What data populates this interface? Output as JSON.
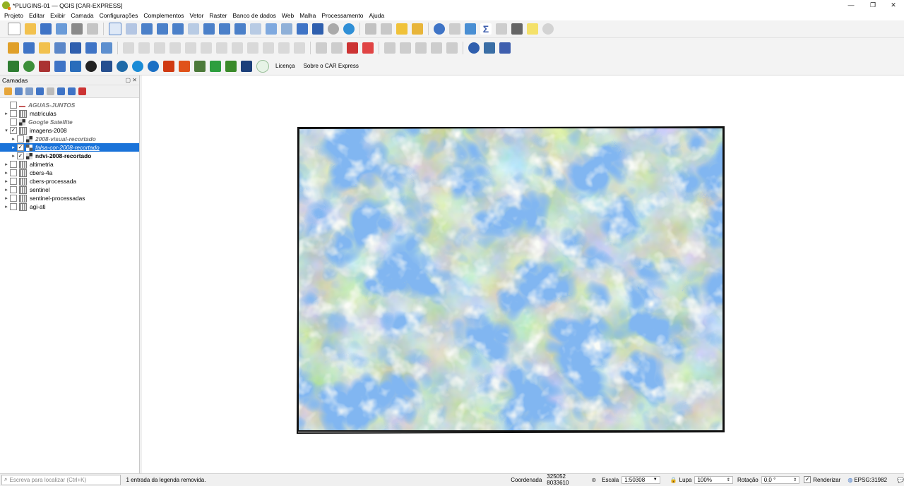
{
  "window": {
    "title": "*PLUGINS-01 — QGIS [CAR-EXPRESS]",
    "minimize": "—",
    "maximize": "❐",
    "close": "✕"
  },
  "menu": [
    "Projeto",
    "Editar",
    "Exibir",
    "Camada",
    "Configurações",
    "Complementos",
    "Vetor",
    "Raster",
    "Banco de dados",
    "Web",
    "Malha",
    "Processamento",
    "Ajuda"
  ],
  "plugin_toolbar": {
    "license": "Licença",
    "about": "Sobre o CAR Express"
  },
  "layers_panel": {
    "title": "Camadas",
    "layers": [
      {
        "name": "AGUAS-JUNTOS",
        "checked": false,
        "expand": "",
        "style": "it"
      },
      {
        "name": "matriculas",
        "checked": false,
        "expand": "▸",
        "style": ""
      },
      {
        "name": "Google Satellite",
        "checked": false,
        "expand": "",
        "style": "it"
      },
      {
        "name": "imagens-2008",
        "checked": true,
        "expand": "▾",
        "style": ""
      },
      {
        "name": "2008-visual-recortado",
        "checked": false,
        "expand": "▸",
        "style": "it"
      },
      {
        "name": "falsa-cor-2008-recortado",
        "checked": true,
        "expand": "▸",
        "style": "sel"
      },
      {
        "name": "ndvi-2008-recortado",
        "checked": true,
        "expand": "▸",
        "style": "bold"
      },
      {
        "name": "altimetria",
        "checked": false,
        "expand": "▸",
        "style": ""
      },
      {
        "name": "cbers-4a",
        "checked": false,
        "expand": "▸",
        "style": ""
      },
      {
        "name": "cbers-processada",
        "checked": false,
        "expand": "▸",
        "style": ""
      },
      {
        "name": "sentinel",
        "checked": false,
        "expand": "▸",
        "style": ""
      },
      {
        "name": "sentinel-processadas",
        "checked": false,
        "expand": "▸",
        "style": ""
      },
      {
        "name": "agi-ati",
        "checked": false,
        "expand": "▸",
        "style": ""
      }
    ]
  },
  "status": {
    "search_placeholder": "Escreva para localizar (Ctrl+K)",
    "message": "1 entrada da legenda removida.",
    "coord_label": "Coordenada",
    "coord_value": "325052  8033610",
    "scale_label": "Escala",
    "scale_value": "1:50308",
    "magnifier_label": "Lupa",
    "magnifier_value": "100%",
    "rotation_label": "Rotação",
    "rotation_value": "0,0 °",
    "render_label": "Renderizar",
    "render_checked": true,
    "crs": "EPSG:31982"
  },
  "colors": {
    "selection": "#1a73d9",
    "water": "#3d7ee0",
    "qgis_green": "#93b023"
  }
}
